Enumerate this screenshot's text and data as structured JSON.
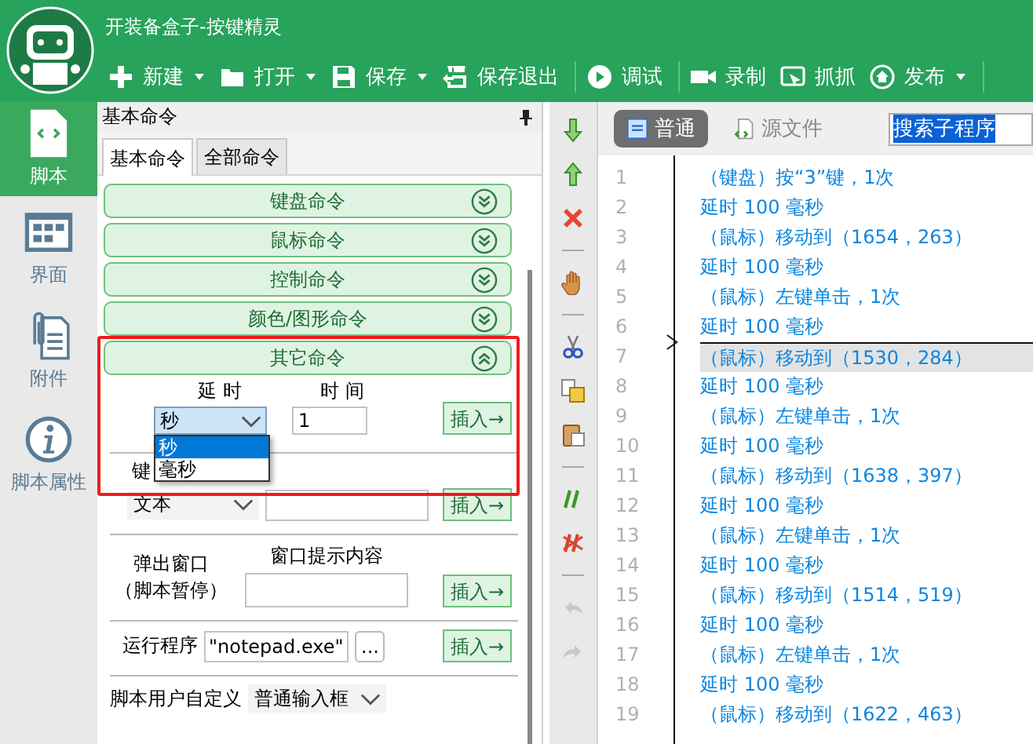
{
  "app": {
    "title": "开装备盒子-按键精灵"
  },
  "toolbar": [
    {
      "label": "新建",
      "dropdown": true
    },
    {
      "label": "打开",
      "dropdown": true
    },
    {
      "label": "保存",
      "dropdown": true
    },
    {
      "label": "保存退出",
      "dropdown": false
    },
    {
      "label": "调试",
      "dropdown": false
    },
    {
      "label": "录制",
      "dropdown": false
    },
    {
      "label": "抓抓",
      "dropdown": false
    },
    {
      "label": "发布",
      "dropdown": true
    }
  ],
  "sidebar": [
    {
      "label": "脚本",
      "selected": true
    },
    {
      "label": "界面",
      "selected": false
    },
    {
      "label": "附件",
      "selected": false
    },
    {
      "label": "脚本属性",
      "selected": false
    }
  ],
  "panel": {
    "title": "基本命令",
    "tabs": [
      {
        "label": "基本命令",
        "selected": true
      },
      {
        "label": "全部命令",
        "selected": false
      }
    ],
    "groups": [
      {
        "label": "键盘命令",
        "expanded": false
      },
      {
        "label": "鼠标命令",
        "expanded": false
      },
      {
        "label": "控制命令",
        "expanded": false
      },
      {
        "label": "颜色/图形命令",
        "expanded": false
      },
      {
        "label": "其它命令",
        "expanded": true
      }
    ],
    "delay": {
      "unit_label": "延时",
      "time_label": "时间",
      "unit": "秒",
      "time": "1",
      "insert": "插入→",
      "options": [
        {
          "label": "秒",
          "selected": true
        },
        {
          "label": "毫秒",
          "selected": false
        }
      ]
    },
    "key_label": "键",
    "text_row": {
      "select": "文本",
      "insert": "插入→"
    },
    "popup": {
      "label_lines": [
        "弹出窗口",
        "（脚本暂停）"
      ],
      "caption": "窗口提示内容",
      "insert": "插入→"
    },
    "run": {
      "label": "运行程序",
      "value": "\"notepad.exe\"",
      "browse": "...",
      "insert": "插入→"
    },
    "custom": {
      "label": "脚本用户自定义",
      "select": "普通输入框"
    }
  },
  "editor": {
    "tabs": [
      {
        "label": "普通",
        "selected": true
      },
      {
        "label": "源文件",
        "selected": false
      }
    ],
    "search": "搜索子程序",
    "lines": [
      {
        "num": "1",
        "text": "（键盘）按“3”键，1次",
        "selected": false
      },
      {
        "num": "2",
        "text": "延时 100 毫秒",
        "selected": false
      },
      {
        "num": "3",
        "text": "（鼠标）移动到（1654，263）",
        "selected": false
      },
      {
        "num": "4",
        "text": "延时 100 毫秒",
        "selected": false
      },
      {
        "num": "5",
        "text": "（鼠标）左键单击，1次",
        "selected": false
      },
      {
        "num": "6",
        "text": "延时 100 毫秒",
        "selected": false
      },
      {
        "num": "7",
        "text": "（鼠标）移动到（1530，284）",
        "selected": true
      },
      {
        "num": "8",
        "text": "延时 100 毫秒",
        "selected": false
      },
      {
        "num": "9",
        "text": "（鼠标）左键单击，1次",
        "selected": false
      },
      {
        "num": "10",
        "text": "延时 100 毫秒",
        "selected": false
      },
      {
        "num": "11",
        "text": "（鼠标）移动到（1638，397）",
        "selected": false
      },
      {
        "num": "12",
        "text": "延时 100 毫秒",
        "selected": false
      },
      {
        "num": "13",
        "text": "（鼠标）左键单击，1次",
        "selected": false
      },
      {
        "num": "14",
        "text": "延时 100 毫秒",
        "selected": false
      },
      {
        "num": "15",
        "text": "（鼠标）移动到（1514，519）",
        "selected": false
      },
      {
        "num": "16",
        "text": "延时 100 毫秒",
        "selected": false
      },
      {
        "num": "17",
        "text": "（鼠标）左键单击，1次",
        "selected": false
      },
      {
        "num": "18",
        "text": "延时 100 毫秒",
        "selected": false
      },
      {
        "num": "19",
        "text": "（鼠标）移动到（1622，463）",
        "selected": false
      }
    ]
  }
}
